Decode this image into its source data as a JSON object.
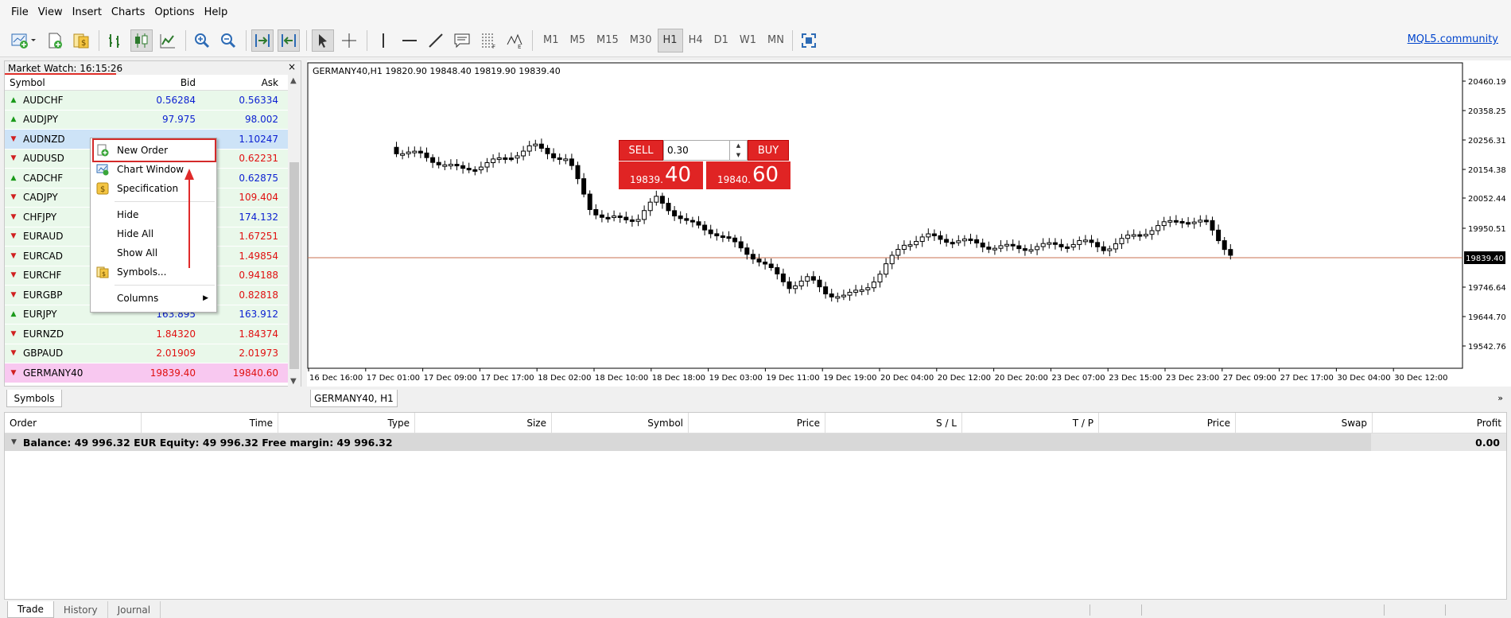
{
  "menu": [
    "File",
    "View",
    "Insert",
    "Charts",
    "Options",
    "Help"
  ],
  "toolbar": {
    "timeframes": [
      "M1",
      "M5",
      "M15",
      "M30",
      "H1",
      "H4",
      "D1",
      "W1",
      "MN"
    ],
    "active_timeframe": "H1",
    "community_link": "MQL5.community"
  },
  "market_watch": {
    "title": "Market Watch: 16:15:26",
    "close": "×",
    "columns": {
      "symbol": "Symbol",
      "bid": "Bid",
      "ask": "Ask"
    },
    "rows": [
      {
        "symbol": "AUDCHF",
        "bid": "0.56284",
        "ask": "0.56334",
        "dir": "up",
        "bid_color": "blue",
        "ask_color": "blue"
      },
      {
        "symbol": "AUDJPY",
        "bid": "97.975",
        "ask": "98.002",
        "dir": "up",
        "bid_color": "blue",
        "ask_color": "blue"
      },
      {
        "symbol": "AUDNZD",
        "bid": "",
        "ask": "1.10247",
        "dir": "dn",
        "bid_color": "red",
        "ask_color": "blue"
      },
      {
        "symbol": "AUDUSD",
        "bid": "",
        "ask": "0.62231",
        "dir": "dn",
        "bid_color": "red",
        "ask_color": "red"
      },
      {
        "symbol": "CADCHF",
        "bid": "",
        "ask": "0.62875",
        "dir": "up",
        "bid_color": "blue",
        "ask_color": "blue"
      },
      {
        "symbol": "CADJPY",
        "bid": "",
        "ask": "109.404",
        "dir": "dn",
        "bid_color": "red",
        "ask_color": "red"
      },
      {
        "symbol": "CHFJPY",
        "bid": "",
        "ask": "174.132",
        "dir": "dn",
        "bid_color": "blue",
        "ask_color": "blue"
      },
      {
        "symbol": "EURAUD",
        "bid": "",
        "ask": "1.67251",
        "dir": "dn",
        "bid_color": "red",
        "ask_color": "red"
      },
      {
        "symbol": "EURCAD",
        "bid": "",
        "ask": "1.49854",
        "dir": "dn",
        "bid_color": "red",
        "ask_color": "red"
      },
      {
        "symbol": "EURCHF",
        "bid": "",
        "ask": "0.94188",
        "dir": "dn",
        "bid_color": "red",
        "ask_color": "red"
      },
      {
        "symbol": "EURGBP",
        "bid": "",
        "ask": "0.82818",
        "dir": "dn",
        "bid_color": "red",
        "ask_color": "red"
      },
      {
        "symbol": "EURJPY",
        "bid": "163.895",
        "ask": "163.912",
        "dir": "up",
        "bid_color": "blue",
        "ask_color": "blue"
      },
      {
        "symbol": "EURNZD",
        "bid": "1.84320",
        "ask": "1.84374",
        "dir": "dn",
        "bid_color": "red",
        "ask_color": "red"
      },
      {
        "symbol": "GBPAUD",
        "bid": "2.01909",
        "ask": "2.01973",
        "dir": "dn",
        "bid_color": "red",
        "ask_color": "red"
      },
      {
        "symbol": "GERMANY40",
        "bid": "19839.40",
        "ask": "19840.60",
        "dir": "dn",
        "bid_color": "red",
        "ask_color": "red"
      }
    ],
    "tab": "Symbols"
  },
  "context_menu": {
    "new_order": "New Order",
    "chart_window": "Chart Window",
    "specification": "Specification",
    "hide": "Hide",
    "hide_all": "Hide All",
    "show_all": "Show All",
    "symbols": "Symbols...",
    "columns": "Columns"
  },
  "chart": {
    "header": "GERMANY40,H1  19820.90 19848.40 19819.90 19839.40",
    "tab": "GERMANY40, H1",
    "sell_label": "SELL",
    "buy_label": "BUY",
    "lot": "0.30",
    "sell_small": "19839.",
    "sell_big": "40",
    "buy_small": "19840.",
    "buy_big": "60",
    "y_ticks": [
      "20460.19",
      "20358.25",
      "20256.31",
      "20154.38",
      "20052.44",
      "19950.51",
      "19746.64",
      "19644.70",
      "19542.76"
    ],
    "current_price": "19839.40",
    "x_ticks": [
      "16 Dec 16:00",
      "17 Dec 01:00",
      "17 Dec 09:00",
      "17 Dec 17:00",
      "18 Dec 02:00",
      "18 Dec 10:00",
      "18 Dec 18:00",
      "19 Dec 03:00",
      "19 Dec 11:00",
      "19 Dec 19:00",
      "20 Dec 04:00",
      "20 Dec 12:00",
      "20 Dec 20:00",
      "23 Dec 07:00",
      "23 Dec 15:00",
      "23 Dec 23:00",
      "27 Dec 09:00",
      "27 Dec 17:00",
      "30 Dec 04:00",
      "30 Dec 12:00"
    ]
  },
  "terminal": {
    "columns": [
      "Order",
      "Time",
      "Type",
      "Size",
      "Symbol",
      "Price",
      "S / L",
      "T / P",
      "Price",
      "Swap",
      "Profit"
    ],
    "balance_line": "Balance: 49 996.32 EUR  Equity: 49 996.32  Free margin: 49 996.32",
    "profit": "0.00",
    "tabs": [
      "Trade",
      "History",
      "Journal"
    ]
  },
  "colors": {
    "sell": "#e02424",
    "buy": "#e02424",
    "bid_line": "#c87050",
    "up": "#1a9a1a",
    "down": "#d02020"
  }
}
